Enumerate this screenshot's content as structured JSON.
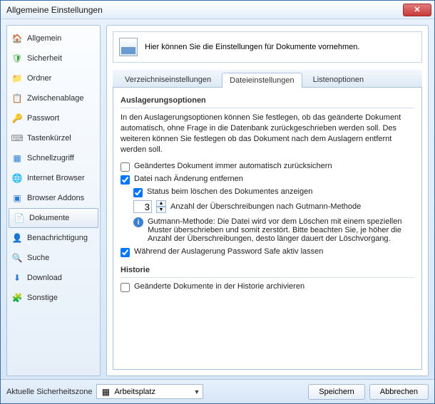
{
  "window": {
    "title": "Allgemeine Einstellungen"
  },
  "sidebar": {
    "items": [
      {
        "label": "Allgemein",
        "glyph": "🏠",
        "color": "#2d7bd1"
      },
      {
        "label": "Sicherheit",
        "glyph": "🛡",
        "color": "#39a339"
      },
      {
        "label": "Ordner",
        "glyph": "📁",
        "color": "#e0a62e"
      },
      {
        "label": "Zwischenablage",
        "glyph": "📋",
        "color": "#c77b38"
      },
      {
        "label": "Passwort",
        "glyph": "🔑",
        "color": "#d99a2b"
      },
      {
        "label": "Tastenkürzel",
        "glyph": "⌨",
        "color": "#888"
      },
      {
        "label": "Schnellzugriff",
        "glyph": "▦",
        "color": "#2d7bd1"
      },
      {
        "label": "Internet Browser",
        "glyph": "🌐",
        "color": "#2d7bd1"
      },
      {
        "label": "Browser Addons",
        "glyph": "▣",
        "color": "#2d7bd1"
      },
      {
        "label": "Dokumente",
        "glyph": "📄",
        "color": "#6b6b6b"
      },
      {
        "label": "Benachrichtigung",
        "glyph": "👤",
        "color": "#d76b2e"
      },
      {
        "label": "Suche",
        "glyph": "🔍",
        "color": "#555"
      },
      {
        "label": "Download",
        "glyph": "⬇",
        "color": "#2d7bd1"
      },
      {
        "label": "Sonstige",
        "glyph": "🧩",
        "color": "#2d7bd1"
      }
    ],
    "active_index": 9
  },
  "banner": {
    "text": "Hier können Sie die Einstellungen für Dokumente vornehmen."
  },
  "tabs": {
    "items": [
      "Verzeichniseinstellungen",
      "Dateieinstellungen",
      "Listenoptionen"
    ],
    "active_index": 1
  },
  "pane": {
    "section1": "Auslagerungsoptionen",
    "desc1": "In den Auslagerungsoptionen können Sie festlegen, ob das geänderte Dokument automatisch, ohne Frage in die Datenbank zurückgeschrieben werden soll. Des weiteren können Sie festlegen ob das Dokument nach dem Auslagern entfernt werden soll.",
    "chk_auto": "Geändertes Dokument immer automatisch zurücksichern",
    "chk_auto_val": false,
    "chk_remove": "Datei nach Änderung entfernen",
    "chk_remove_val": true,
    "chk_status": "Status beim löschen des Dokumentes anzeigen",
    "chk_status_val": true,
    "spin_value": "3",
    "spin_label": "Anzahl der Überschreibungen nach Gutmann-Methode",
    "info": "Gutmann-Methode: Die Datei wird vor dem Löschen mit einem speziellen Muster überschrieben und somit zerstört. Bitte beachten Sie, je höher die Anzahl der Überschreibungen, desto länger dauert der Löschvorgang.",
    "chk_active": "Während der Auslagerung Password Safe aktiv lassen",
    "chk_active_val": true,
    "section2": "Historie",
    "chk_history": "Geänderte Dokumente in der Historie archivieren",
    "chk_history_val": false
  },
  "footer": {
    "zone_label": "Aktuelle Sicherheitszone",
    "zone_value": "Arbeitsplatz",
    "save": "Speichern",
    "cancel": "Abbrechen"
  }
}
